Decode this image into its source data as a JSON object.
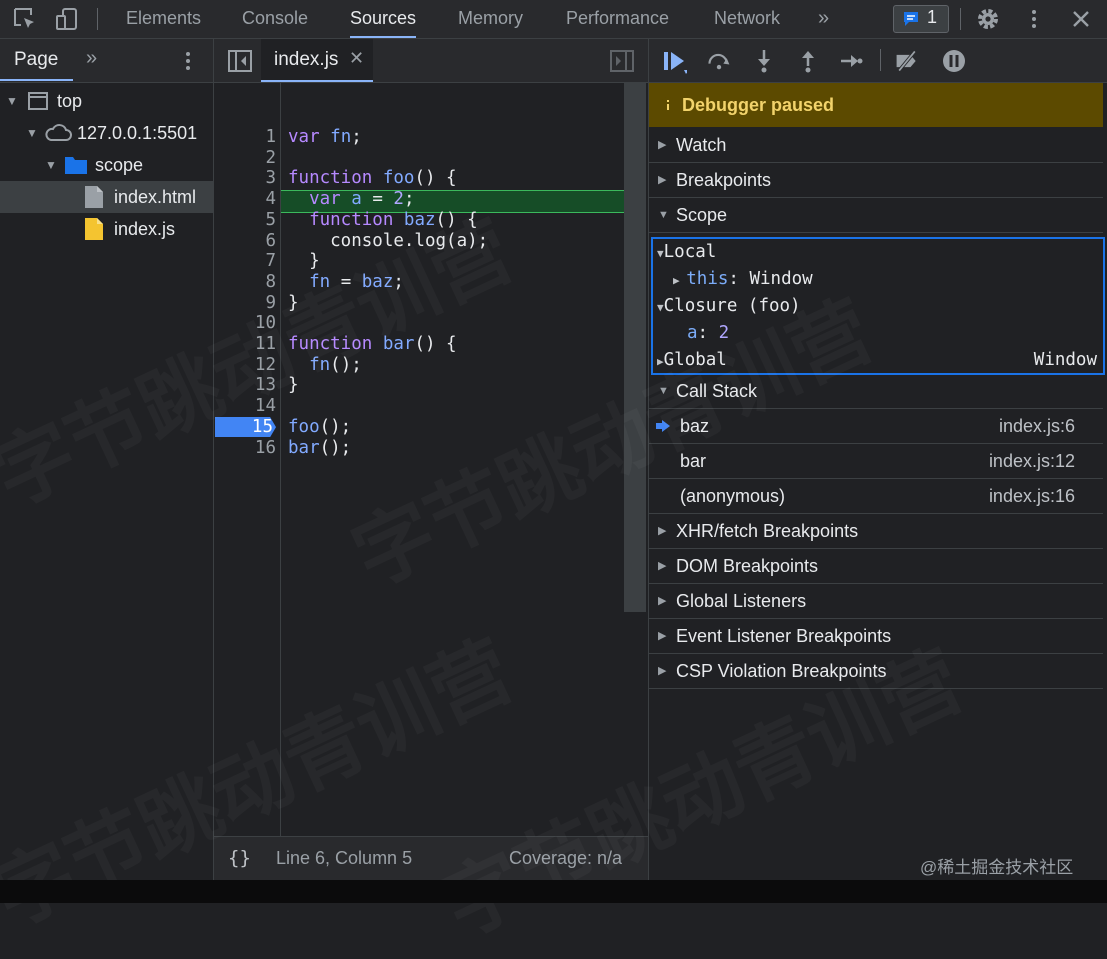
{
  "toolbar": {
    "tabs": [
      "Elements",
      "Console",
      "Sources",
      "Memory",
      "Performance",
      "Network"
    ],
    "active_tab": "Sources",
    "issues_count": "1"
  },
  "navigator": {
    "tab_label": "Page",
    "tree": [
      {
        "label": "top",
        "icon": "frame-icon"
      },
      {
        "label": "127.0.0.1:5501",
        "icon": "cloud-icon"
      },
      {
        "label": "scope",
        "icon": "folder-icon"
      },
      {
        "label": "index.html",
        "icon": "file-icon"
      },
      {
        "label": "index.js",
        "icon": "js-file-icon"
      }
    ]
  },
  "editor": {
    "tab_label": "index.js",
    "lines": [
      "var fn;",
      "",
      "function foo() {",
      "  var a = 2;",
      "  function baz() {",
      "    console.log(a);",
      "  }",
      "  fn = baz;",
      "}",
      "",
      "function bar() {",
      "  fn();",
      "}",
      "",
      "foo();",
      "bar();"
    ],
    "line_numbers": [
      "1",
      "2",
      "3",
      "4",
      "5",
      "6",
      "7",
      "8",
      "9",
      "10",
      "11",
      "12",
      "13",
      "14",
      "15",
      "16"
    ],
    "breakpoint_line": "15",
    "status_position": "Line 6, Column 5",
    "coverage": "Coverage: n/a",
    "format_button": "{}"
  },
  "debugger": {
    "paused_label": "Debugger paused",
    "sections": {
      "watch": "Watch",
      "breakpoints": "Breakpoints",
      "scope": "Scope",
      "call_stack": "Call Stack",
      "xhr": "XHR/fetch Breakpoints",
      "dom": "DOM Breakpoints",
      "global_listeners": "Global Listeners",
      "event_listener": "Event Listener Breakpoints",
      "csp": "CSP Violation Breakpoints"
    },
    "scope": {
      "local": "Local",
      "this_key": "this",
      "this_value": "Window",
      "closure": "Closure (foo)",
      "a_key": "a",
      "a_value": "2",
      "global": "Global",
      "global_value": "Window"
    },
    "call_stack": [
      {
        "name": "baz",
        "location": "index.js:6"
      },
      {
        "name": "bar",
        "location": "index.js:12"
      },
      {
        "name": "(anonymous)",
        "location": "index.js:16"
      }
    ]
  },
  "watermark": "字节跳动青训营",
  "credit": "@稀土掘金技术社区",
  "colors": {
    "accent": "#8ab4f8",
    "exec_line": "#164d27",
    "paused_banner": "#5c4a00",
    "breakpoint": "#4285f4"
  }
}
